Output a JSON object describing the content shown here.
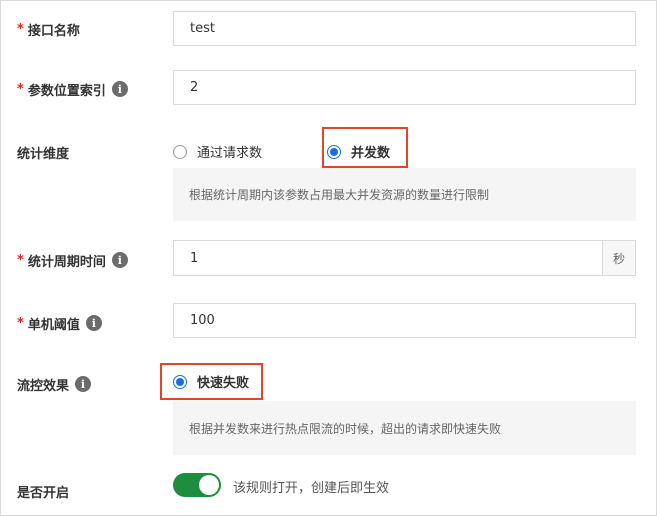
{
  "fields": {
    "api_name": {
      "label": "接口名称",
      "required_mark": "*",
      "value": "test"
    },
    "param_index": {
      "label": "参数位置索引",
      "required_mark": "*",
      "value": "2"
    },
    "stat_dimension": {
      "label": "统计维度",
      "options": [
        "通过请求数",
        "并发数"
      ],
      "selected": "并发数",
      "hint": "根据统计周期内该参数占用最大并发资源的数量进行限制"
    },
    "stat_period": {
      "label": "统计周期时间",
      "required_mark": "*",
      "value": "1",
      "unit": "秒"
    },
    "threshold": {
      "label": "单机阈值",
      "required_mark": "*",
      "value": "100"
    },
    "flow_effect": {
      "label": "流控效果",
      "options": [
        "快速失败"
      ],
      "selected": "快速失败",
      "hint": "根据并发数来进行热点限流的时候，超出的请求即快速失败"
    },
    "enabled": {
      "label": "是否开启",
      "state": true,
      "description": "该规则打开，创建后即生效"
    }
  },
  "info_icon_glyph": "i",
  "colors": {
    "accent": "#1a6fe0",
    "highlight": "#e0462a",
    "toggle_on": "#1e8e3e",
    "required": "#e02020"
  }
}
